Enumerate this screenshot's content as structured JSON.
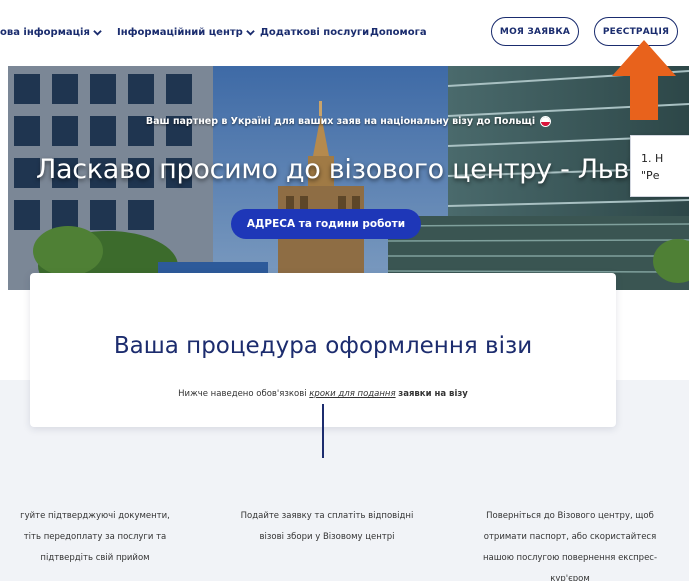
{
  "nav": {
    "items": [
      {
        "label": "ова інформація",
        "has_chevron": true
      },
      {
        "label": "Інформаційний центр",
        "has_chevron": true
      },
      {
        "label": "Додаткові послуги",
        "has_chevron": false
      },
      {
        "label": "Допомога",
        "has_chevron": false
      }
    ],
    "my_application": "МОЯ ЗАЯВКА",
    "register": "РЕЄСТРАЦІЯ"
  },
  "hero": {
    "subtitle": "Ваш партнер в Україні для ваших заяв на національну візу до Польщі",
    "title": "Ласкаво просимо до візового центру - Львів",
    "button": "АДРЕСА та години роботи"
  },
  "tooltip": {
    "line1": "1. Н",
    "line2": "\"Ре"
  },
  "card": {
    "title": "Ваша процедура оформлення візи",
    "sub_prefix": "Нижче наведено обов'язкові",
    "sub_link": "кроки для подання",
    "sub_bold": "заявки на візу"
  },
  "steps": [
    {
      "lines": [
        "гуйте підтверджуючі документи,",
        "тіть передоплату за послуги та",
        "підтвердіть свій прийом"
      ]
    },
    {
      "lines": [
        "Подайте заявку та сплатіть відповідні",
        "візові збори у Візовому центрі"
      ]
    },
    {
      "lines": [
        "Поверніться до Візового центру, щоб",
        "отримати паспорт, або скористайтеся",
        "нашою послугою повернення експрес-",
        "кур'єром"
      ]
    }
  ],
  "colors": {
    "brand_navy": "#1a2c6e",
    "button_blue": "#1e37b8",
    "arrow_orange": "#e8621c",
    "lower_bg": "#f1f3f7"
  },
  "icons": {
    "chevron": "chevron-down-icon",
    "flag": "poland-flag-icon",
    "arrow": "up-arrow-icon"
  }
}
